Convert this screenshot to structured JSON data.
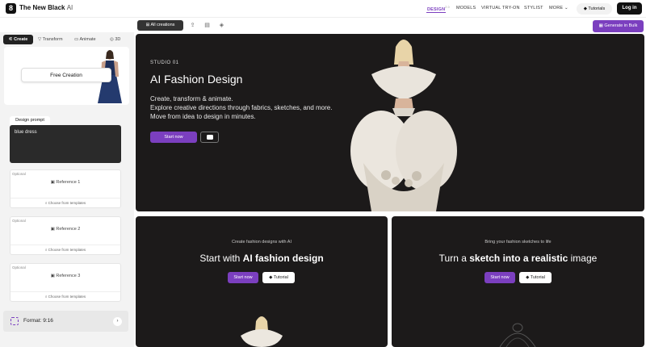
{
  "app": {
    "brand": "The New Black",
    "brand_suffix": "AI",
    "accent": "#7b3fbf"
  },
  "nav": {
    "design": "DESIGN",
    "design_badge": "2.0",
    "models": "MODELS",
    "virtual": "VIRTUAL TRY-ON",
    "stylist": "STYLIST",
    "more": "MORE",
    "tutorials": "Tutorials",
    "login": "Log in"
  },
  "left_tabs": [
    "Create",
    "Transform",
    "Animate",
    "3D"
  ],
  "free_creation": "Free Creation",
  "prompt": {
    "label": "Design prompt",
    "value": "blue dress"
  },
  "references": [
    {
      "optional": "Optional",
      "label": "Reference 1",
      "template": "Choose from templates"
    },
    {
      "optional": "Optional",
      "label": "Reference 2",
      "template": "Choose from templates"
    },
    {
      "optional": "Optional",
      "label": "Reference 3",
      "template": "Choose from templates"
    }
  ],
  "format": {
    "label": "Format: 9:16"
  },
  "toolbar": {
    "all_creations": "All creations",
    "generate_bulk": "Generate in Bulk"
  },
  "hero": {
    "kicker": "STUDIO 01",
    "title": "AI Fashion Design",
    "lines": [
      "Create, transform & animate.",
      "Explore creative directions through fabrics, sketches, and more.",
      "Move from idea to design in minutes."
    ],
    "start": "Start now"
  },
  "cards": [
    {
      "kicker": "Create fashion designs with AI",
      "title_pre": "Start with ",
      "title_bold": "AI fashion design",
      "title_post": "",
      "start": "Start now",
      "tutorial": "Tutorial"
    },
    {
      "kicker": "Bring your fashion sketches to life",
      "title_pre": "Turn a ",
      "title_bold": "sketch into a realistic",
      "title_post": " image",
      "start": "Start now",
      "tutorial": "Tutorial"
    }
  ]
}
